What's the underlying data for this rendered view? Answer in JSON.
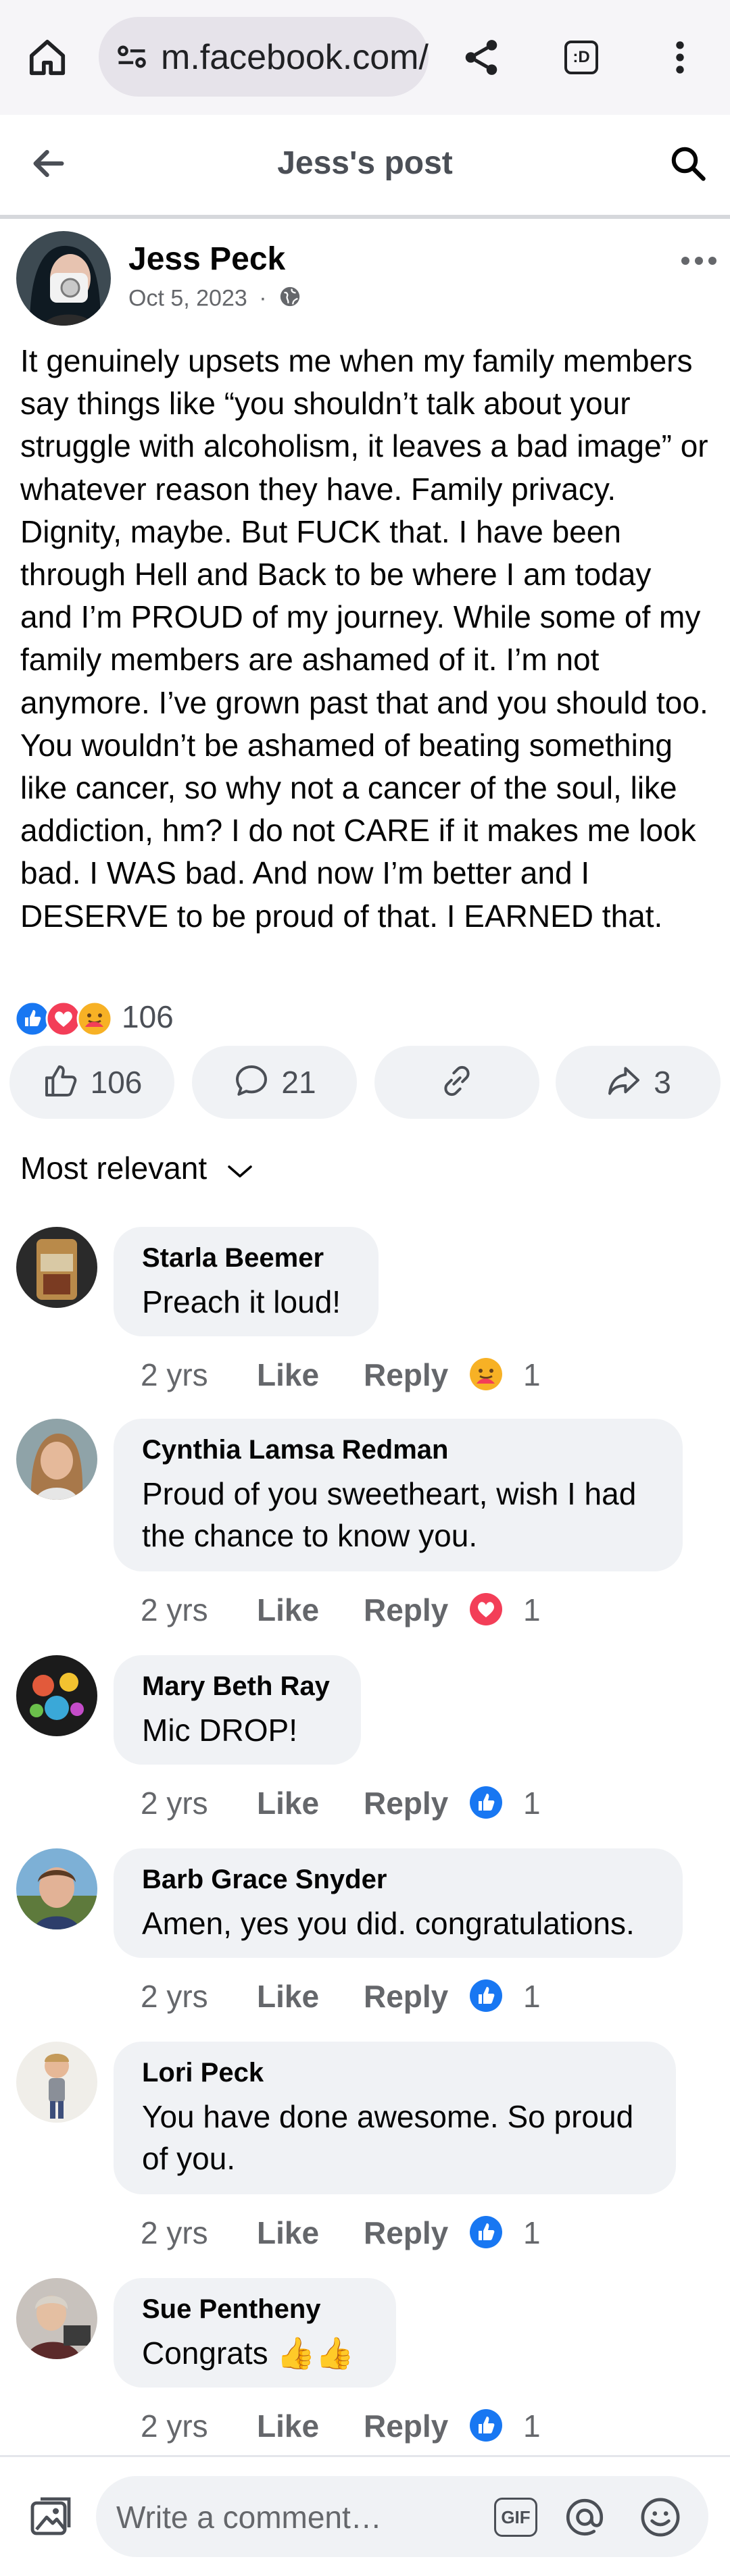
{
  "browser": {
    "url": "m.facebook.com/",
    "tab_count": ":D"
  },
  "header": {
    "title": "Jess's post"
  },
  "post": {
    "author": "Jess Peck",
    "date": "Oct 5, 2023",
    "separator": "·",
    "body": "It genuinely upsets me when my family members say things like “you shouldn’t talk about your struggle with alcoholism, it leaves a bad image” or whatever reason they have. Family privacy. Dignity, maybe. But FUCK that. I have been through Hell and Back to be where I am today and I’m PROUD of my journey. While some of my family members are ashamed of it. I’m not anymore. I’ve grown past that and you should too. You wouldn’t be ashamed of beating something like cancer, so why not a cancer of the soul, like addiction, hm? I do not CARE if it makes me look bad. I WAS bad. And now I’m better and I DESERVE to be proud of that. I EARNED that.",
    "reaction_total": "106",
    "actions": {
      "likes": "106",
      "comments": "21",
      "shares": "3"
    }
  },
  "sort": {
    "label": "Most relevant"
  },
  "comments": [
    {
      "name": "Starla Beemer",
      "text": "Preach it loud!",
      "time": "2 yrs",
      "like": "Like",
      "reply": "Reply",
      "reaction": "care",
      "count": "1"
    },
    {
      "name": "Cynthia Lamsa Redman",
      "text": "Proud of you sweetheart, wish I had the chance to know you.",
      "time": "2 yrs",
      "like": "Like",
      "reply": "Reply",
      "reaction": "love",
      "count": "1"
    },
    {
      "name": "Mary Beth Ray",
      "text": "Mic DROP!",
      "time": "2 yrs",
      "like": "Like",
      "reply": "Reply",
      "reaction": "like",
      "count": "1"
    },
    {
      "name": "Barb Grace Snyder",
      "text": "Amen, yes you did. congratulations.",
      "time": "2 yrs",
      "like": "Like",
      "reply": "Reply",
      "reaction": "like",
      "count": "1"
    },
    {
      "name": "Lori Peck",
      "text": "You have done awesome. So proud of you.",
      "time": "2 yrs",
      "like": "Like",
      "reply": "Reply",
      "reaction": "like",
      "count": "1"
    },
    {
      "name": "Sue Pentheny",
      "text": "Congrats 👍👍",
      "time": "2 yrs",
      "like": "Like",
      "reply": "Reply",
      "reaction": "like",
      "count": "1"
    }
  ],
  "composer": {
    "placeholder": "Write a comment…",
    "gif": "GIF"
  },
  "colors": {
    "facebook_blue": "#1877f2",
    "love_red": "#f33e58",
    "care_yellow": "#f7b125",
    "bubble_gray": "#f0f2f5",
    "meta_gray": "#65676b"
  },
  "icons": [
    "home-icon",
    "site-settings-icon",
    "share-icon",
    "tabs-icon",
    "more-vertical-icon",
    "back-arrow-icon",
    "search-icon",
    "more-horizontal-icon",
    "globe-icon",
    "like-icon",
    "comment-icon",
    "link-icon",
    "share-arrow-icon",
    "chevron-down-icon",
    "photo-icon",
    "gif-icon",
    "at-icon",
    "emoji-icon"
  ]
}
